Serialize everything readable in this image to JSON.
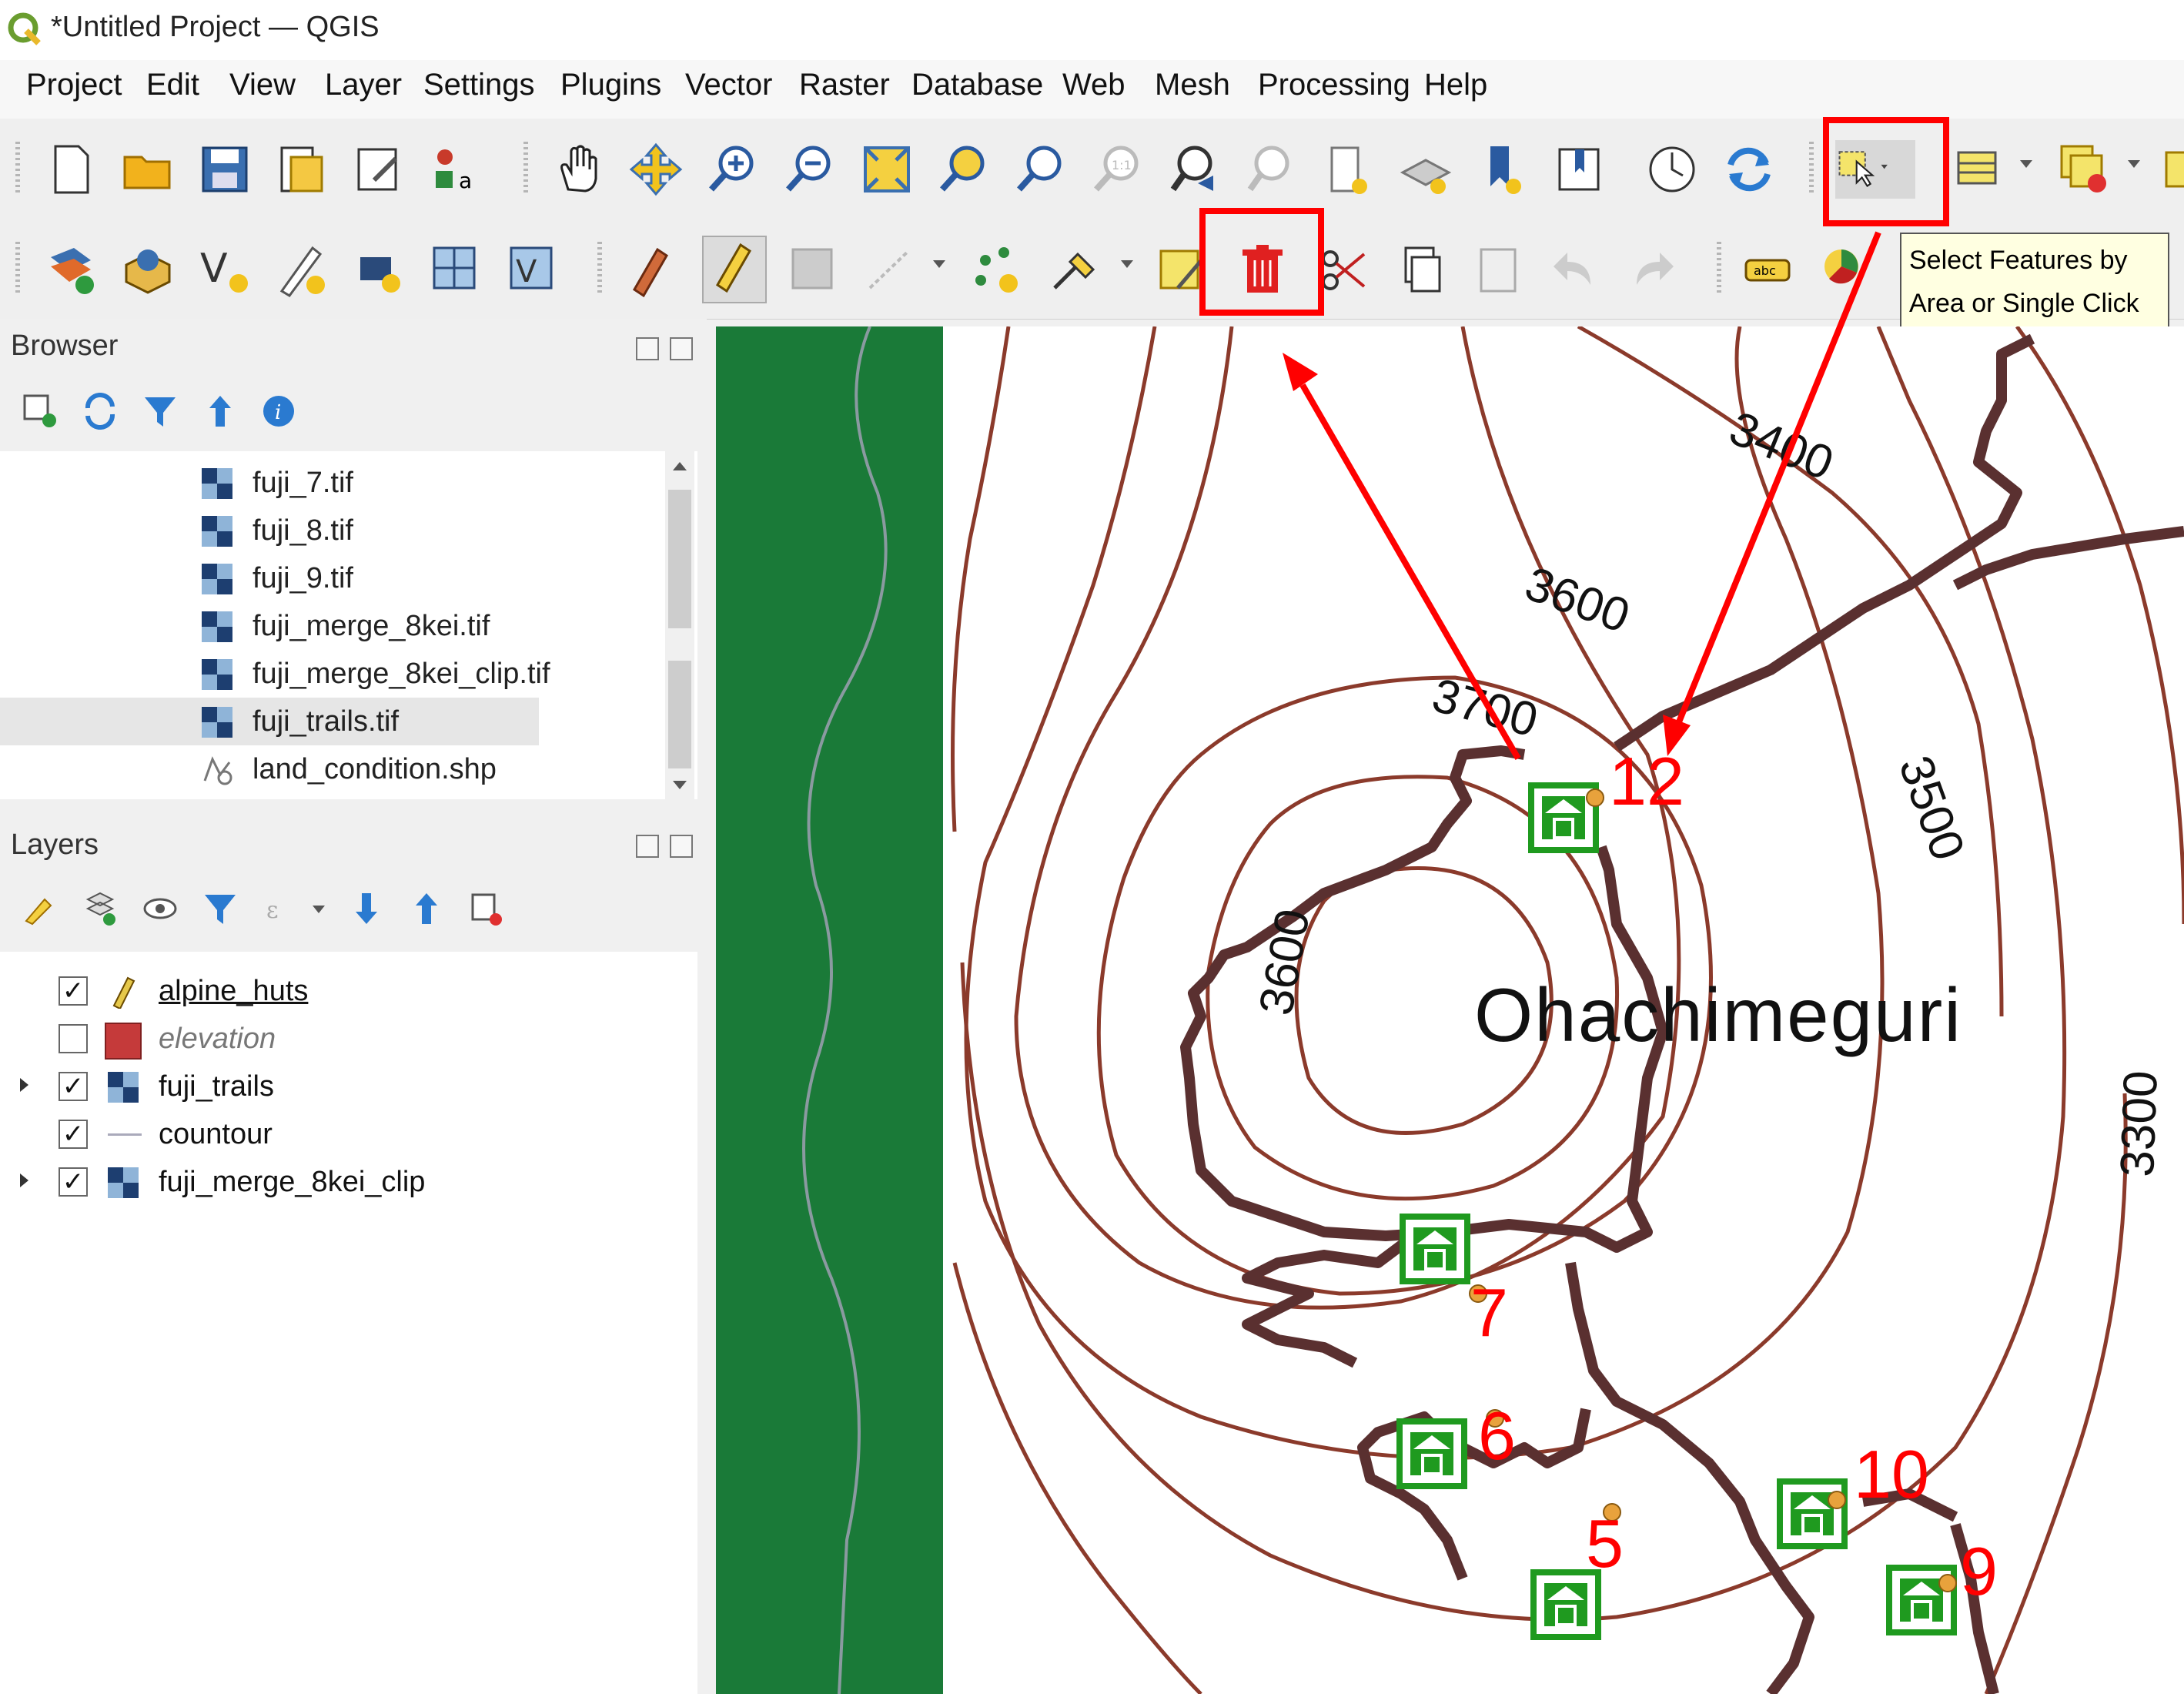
{
  "window": {
    "title": "*Untitled Project — QGIS"
  },
  "menu": [
    "Project",
    "Edit",
    "View",
    "Layer",
    "Settings",
    "Plugins",
    "Vector",
    "Raster",
    "Database",
    "Web",
    "Mesh",
    "Processing",
    "Help"
  ],
  "tooltip": {
    "line1": "Select Features by",
    "line2": "Area or Single Click"
  },
  "browser": {
    "title": "Browser",
    "items": [
      {
        "label": "fuji_7.tif",
        "icon": "raster-icon"
      },
      {
        "label": "fuji_8.tif",
        "icon": "raster-icon"
      },
      {
        "label": "fuji_9.tif",
        "icon": "raster-icon"
      },
      {
        "label": "fuji_merge_8kei.tif",
        "icon": "raster-icon"
      },
      {
        "label": "fuji_merge_8kei_clip.tif",
        "icon": "raster-icon"
      },
      {
        "label": "fuji_trails.tif",
        "icon": "raster-icon"
      },
      {
        "label": "land_condition.shp",
        "icon": "vector-icon"
      }
    ]
  },
  "layers": {
    "title": "Layers",
    "items": [
      {
        "label": "alpine_huts",
        "checked": "✓",
        "icon": "editing-pencil-icon"
      },
      {
        "label": "elevation",
        "checked": "",
        "icon": "red-fill-icon"
      },
      {
        "label": "fuji_trails",
        "checked": "✓",
        "icon": "raster-icon"
      },
      {
        "label": "countour",
        "checked": "✓",
        "icon": "line-icon"
      },
      {
        "label": "fuji_merge_8kei_clip",
        "checked": "✓",
        "icon": "raster-icon"
      }
    ]
  },
  "map": {
    "place_label": "Ohachimeguri",
    "contours": [
      "3400",
      "3600",
      "3700",
      "3500",
      "3600",
      "3300"
    ],
    "huts": [
      "12",
      "7",
      "6",
      "5",
      "10",
      "9"
    ],
    "colors": {
      "contour": "#8b3a2b",
      "trail": "#5a3030",
      "forest": "#1a7a38",
      "highlight": "#ff0000",
      "hut": "#1f9a1f"
    }
  }
}
